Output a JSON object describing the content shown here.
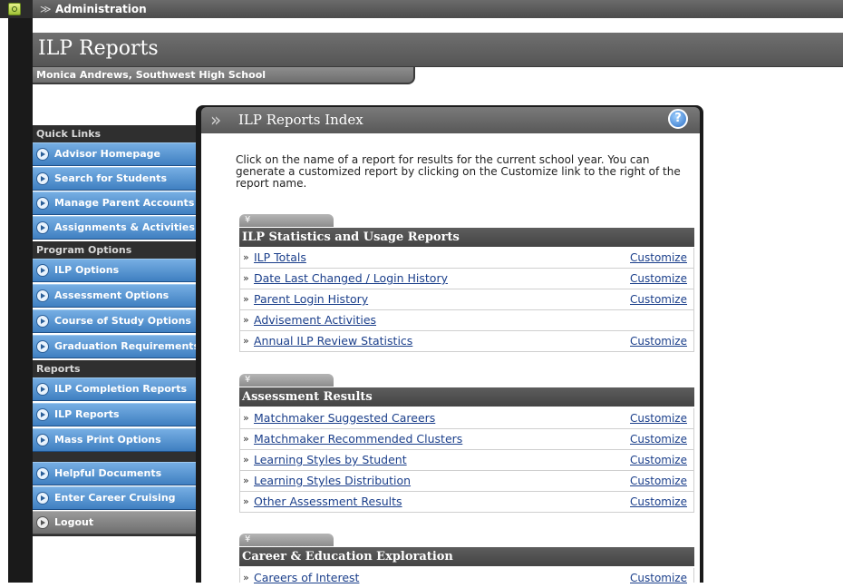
{
  "topbar": {
    "admin_label": "Administration",
    "chevron_glyph": "≫"
  },
  "header": {
    "title": "ILP Reports",
    "user": "Monica Andrews, Southwest High School"
  },
  "sidebar": {
    "quick_links_heading": "Quick Links",
    "quick_links": [
      {
        "label": "Advisor Homepage"
      },
      {
        "label": "Search for Students"
      },
      {
        "label": "Manage Parent Accounts"
      },
      {
        "label": "Assignments & Activities"
      }
    ],
    "program_options_heading": "Program Options",
    "program_options": [
      {
        "label": "ILP Options"
      },
      {
        "label": "Assessment Options"
      },
      {
        "label": "Course of Study Options"
      },
      {
        "label": "Graduation Requirements"
      }
    ],
    "reports_heading": "Reports",
    "reports": [
      {
        "label": "ILP Completion Reports"
      },
      {
        "label": "ILP Reports"
      },
      {
        "label": "Mass Print Options"
      }
    ],
    "other": [
      {
        "label": "Helpful Documents"
      },
      {
        "label": "Enter Career Cruising"
      }
    ],
    "logout_label": "Logout"
  },
  "panel": {
    "title": "ILP Reports Index",
    "chevron_glyph": "»",
    "help_glyph": "?",
    "intro": "Click on the name of a report for results for the current school year. You can generate a customized report by clicking on the Customize link to the right of the report name."
  },
  "sections": [
    {
      "toggle_glyph": "¥",
      "title": "ILP Statistics and Usage Reports",
      "rows": [
        {
          "bullet": "»",
          "name": "ILP Totals",
          "customize": "Customize"
        },
        {
          "bullet": "»",
          "name": "Date Last Changed / Login History",
          "customize": "Customize"
        },
        {
          "bullet": "»",
          "name": "Parent Login History",
          "customize": "Customize"
        },
        {
          "bullet": "»",
          "name": "Advisement Activities",
          "customize": ""
        },
        {
          "bullet": "»",
          "name": "Annual ILP Review Statistics",
          "customize": "Customize"
        }
      ]
    },
    {
      "toggle_glyph": "¥",
      "title": "Assessment Results",
      "rows": [
        {
          "bullet": "»",
          "name": "Matchmaker Suggested Careers",
          "customize": "Customize"
        },
        {
          "bullet": "»",
          "name": "Matchmaker Recommended Clusters",
          "customize": "Customize"
        },
        {
          "bullet": "»",
          "name": "Learning Styles by Student",
          "customize": "Customize"
        },
        {
          "bullet": "»",
          "name": "Learning Styles Distribution",
          "customize": "Customize"
        },
        {
          "bullet": "»",
          "name": "Other Assessment Results",
          "customize": "Customize"
        }
      ]
    },
    {
      "toggle_glyph": "¥",
      "title": "Career & Education Exploration",
      "rows": [
        {
          "bullet": "»",
          "name": "Careers of Interest",
          "customize": "Customize"
        }
      ]
    }
  ]
}
